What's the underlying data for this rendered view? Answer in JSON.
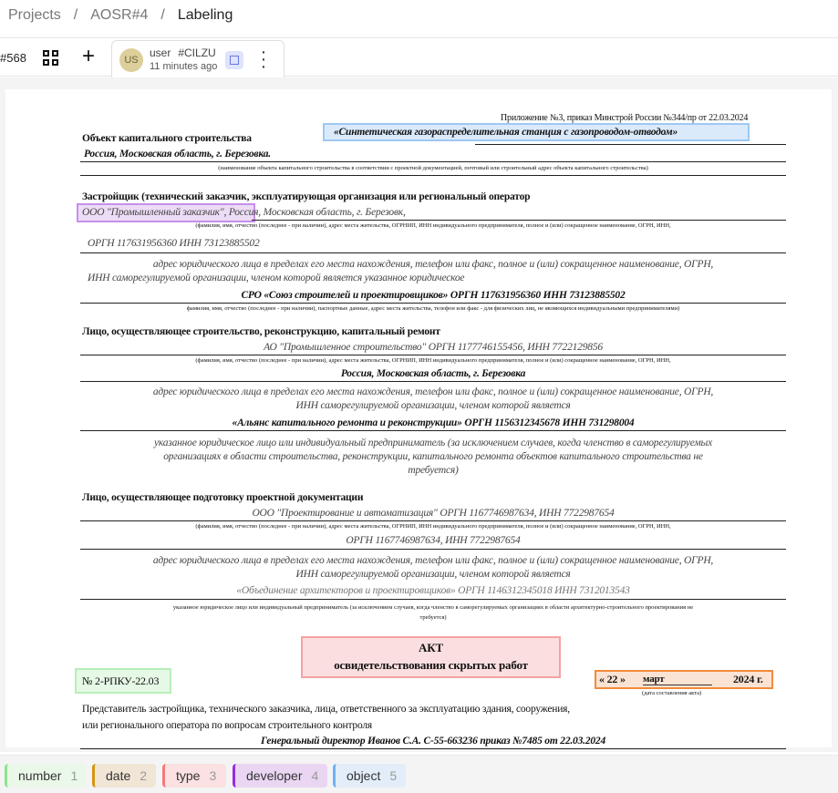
{
  "breadcrumb": [
    "Projects",
    "AOSR#4",
    "Labeling"
  ],
  "toolbar": {
    "task_id": "#568",
    "annotation": {
      "avatar": "US",
      "user": "user",
      "code": "#CILZU",
      "time": "11 minutes ago"
    }
  },
  "document": {
    "appendix": "Приложение №3, приказ Минстрой России №344/пр от 22.03.2024",
    "object_label": "Объект капитального строительства",
    "object_name": "«Синтетическая газораспределительная станция с газопроводом-отводом»",
    "object_address": "Россия, Московская область, г. Березовка.",
    "object_hint": "(наименование объекта капитального строительства в соответствии с проектной документацией, почтовый или строительный адрес объекта капитального строительства)",
    "developer_label": "Застройщик (технический заказчик, эксплуатирующая организация или региональный оператор",
    "developer_name": "ООО \"Промышленный заказчик\"",
    "developer_address": ", Россия, Московская область, г. Березовк,",
    "person_hint": "(фамилия, имя, отчество (последнее - при наличии), адрес места жительства, ОГРНИП, ИНН индивидуального предпринимателя, полное и (или) сокращенное наименование, ОГРН, ИНН,",
    "developer_ogrn": "ОРГН 117631956360 ИНН 73123885502",
    "legal_hint_1": "адрес юридического лица в пределах его места нахождения, телефон или факс, полное и (или) сокращенное наименование, ОГРН,",
    "legal_hint_2a": "ИНН саморегулируемой организации, членом которой является указанное  юридическое",
    "developer_sro": "СРО «Союз строителей и проектировщиков» ОРГН 117631956360 ИНН 73123885502",
    "physical_hint": "фамилия, имя, отчество (последнее - при наличии), паспортные данные, адрес места жительства, телефон или факс - для физических лиц, не являющихся индивидуальными предпринимателями)",
    "builder_label": "Лицо, осуществляющее строительство, реконструкцию, капитальный ремонт",
    "builder_name": "АО \"Промышленное строительство\" ОРГН 1177746155456, ИНН 7722129856",
    "builder_address": "Россия, Московская область, г. Березовка",
    "legal_hint_2b": "ИНН саморегулируемой организации, членом которой является",
    "builder_sro": "«Альянс капитального ремонта и реконструкции» ОРГН 1156312345678 ИНН 731298004",
    "builder_note_1": "указанное юридическое лицо или индивидуальный предприниматель (за исключением случаев, когда членство в саморегулируемых",
    "builder_note_2": "организациях в области строительства, реконструкции, капитального  ремонта объектов капитального строительства не",
    "builder_note_3": "требуется)",
    "designer_label": "Лицо, осуществляющее подготовку проектной документации",
    "designer_name": "ООО \"Проектирование и автоматизация\" ОРГН 1167746987634, ИНН 7722987654",
    "designer_ogrn": "ОРГН 1167746987634, ИНН 7722987654",
    "designer_sro": "«Объединение архитекторов и проектировщиков» ОРГН 1146312345018 ИНН 7312013543",
    "designer_note_1": "указанное юридическое лицо или индивидуальный предприниматель (за исключением случаев, когда членство в саморегулируемых организациях в области архитектурно-строительного проектирования не",
    "designer_note_2": "требуется)",
    "act_title": "АКТ",
    "act_subtitle": "освидетельствования скрытых работ",
    "act_number": "№ 2-РПКУ-22.03",
    "date_day": "« 22 »",
    "date_month": "март",
    "date_year": "2024 г.",
    "date_hint": "(дата составления акта)",
    "rep_label_1": "Представитель застройщика, технического заказчика, лица, ответственного за эксплуатацию здания, сооружения,",
    "rep_label_2": "или регионального оператора по вопросам строительного контроля",
    "rep_value": "Генеральный директор Иванов С.А. С-55-663236 приказ №7485 от 22.03.2024"
  },
  "labels": [
    {
      "name": "number",
      "key": "1",
      "color": "#8fe38f"
    },
    {
      "name": "date",
      "key": "2",
      "color": "#d4940f"
    },
    {
      "name": "type",
      "key": "3",
      "color": "#f47a7a"
    },
    {
      "name": "developer",
      "key": "4",
      "color": "#9a2be0"
    },
    {
      "name": "object",
      "key": "5",
      "color": "#6fb0f5"
    }
  ]
}
